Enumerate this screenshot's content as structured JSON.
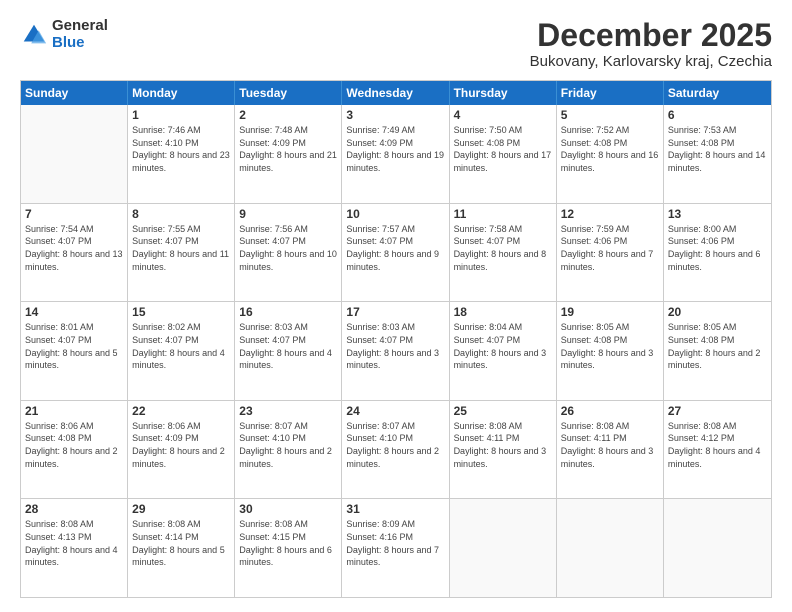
{
  "logo": {
    "general": "General",
    "blue": "Blue"
  },
  "title": "December 2025",
  "subtitle": "Bukovany, Karlovarsky kraj, Czechia",
  "headers": [
    "Sunday",
    "Monday",
    "Tuesday",
    "Wednesday",
    "Thursday",
    "Friday",
    "Saturday"
  ],
  "weeks": [
    [
      {
        "day": "",
        "sunrise": "",
        "sunset": "",
        "daylight": ""
      },
      {
        "day": "1",
        "sunrise": "Sunrise: 7:46 AM",
        "sunset": "Sunset: 4:10 PM",
        "daylight": "Daylight: 8 hours and 23 minutes."
      },
      {
        "day": "2",
        "sunrise": "Sunrise: 7:48 AM",
        "sunset": "Sunset: 4:09 PM",
        "daylight": "Daylight: 8 hours and 21 minutes."
      },
      {
        "day": "3",
        "sunrise": "Sunrise: 7:49 AM",
        "sunset": "Sunset: 4:09 PM",
        "daylight": "Daylight: 8 hours and 19 minutes."
      },
      {
        "day": "4",
        "sunrise": "Sunrise: 7:50 AM",
        "sunset": "Sunset: 4:08 PM",
        "daylight": "Daylight: 8 hours and 17 minutes."
      },
      {
        "day": "5",
        "sunrise": "Sunrise: 7:52 AM",
        "sunset": "Sunset: 4:08 PM",
        "daylight": "Daylight: 8 hours and 16 minutes."
      },
      {
        "day": "6",
        "sunrise": "Sunrise: 7:53 AM",
        "sunset": "Sunset: 4:08 PM",
        "daylight": "Daylight: 8 hours and 14 minutes."
      }
    ],
    [
      {
        "day": "7",
        "sunrise": "Sunrise: 7:54 AM",
        "sunset": "Sunset: 4:07 PM",
        "daylight": "Daylight: 8 hours and 13 minutes."
      },
      {
        "day": "8",
        "sunrise": "Sunrise: 7:55 AM",
        "sunset": "Sunset: 4:07 PM",
        "daylight": "Daylight: 8 hours and 11 minutes."
      },
      {
        "day": "9",
        "sunrise": "Sunrise: 7:56 AM",
        "sunset": "Sunset: 4:07 PM",
        "daylight": "Daylight: 8 hours and 10 minutes."
      },
      {
        "day": "10",
        "sunrise": "Sunrise: 7:57 AM",
        "sunset": "Sunset: 4:07 PM",
        "daylight": "Daylight: 8 hours and 9 minutes."
      },
      {
        "day": "11",
        "sunrise": "Sunrise: 7:58 AM",
        "sunset": "Sunset: 4:07 PM",
        "daylight": "Daylight: 8 hours and 8 minutes."
      },
      {
        "day": "12",
        "sunrise": "Sunrise: 7:59 AM",
        "sunset": "Sunset: 4:06 PM",
        "daylight": "Daylight: 8 hours and 7 minutes."
      },
      {
        "day": "13",
        "sunrise": "Sunrise: 8:00 AM",
        "sunset": "Sunset: 4:06 PM",
        "daylight": "Daylight: 8 hours and 6 minutes."
      }
    ],
    [
      {
        "day": "14",
        "sunrise": "Sunrise: 8:01 AM",
        "sunset": "Sunset: 4:07 PM",
        "daylight": "Daylight: 8 hours and 5 minutes."
      },
      {
        "day": "15",
        "sunrise": "Sunrise: 8:02 AM",
        "sunset": "Sunset: 4:07 PM",
        "daylight": "Daylight: 8 hours and 4 minutes."
      },
      {
        "day": "16",
        "sunrise": "Sunrise: 8:03 AM",
        "sunset": "Sunset: 4:07 PM",
        "daylight": "Daylight: 8 hours and 4 minutes."
      },
      {
        "day": "17",
        "sunrise": "Sunrise: 8:03 AM",
        "sunset": "Sunset: 4:07 PM",
        "daylight": "Daylight: 8 hours and 3 minutes."
      },
      {
        "day": "18",
        "sunrise": "Sunrise: 8:04 AM",
        "sunset": "Sunset: 4:07 PM",
        "daylight": "Daylight: 8 hours and 3 minutes."
      },
      {
        "day": "19",
        "sunrise": "Sunrise: 8:05 AM",
        "sunset": "Sunset: 4:08 PM",
        "daylight": "Daylight: 8 hours and 3 minutes."
      },
      {
        "day": "20",
        "sunrise": "Sunrise: 8:05 AM",
        "sunset": "Sunset: 4:08 PM",
        "daylight": "Daylight: 8 hours and 2 minutes."
      }
    ],
    [
      {
        "day": "21",
        "sunrise": "Sunrise: 8:06 AM",
        "sunset": "Sunset: 4:08 PM",
        "daylight": "Daylight: 8 hours and 2 minutes."
      },
      {
        "day": "22",
        "sunrise": "Sunrise: 8:06 AM",
        "sunset": "Sunset: 4:09 PM",
        "daylight": "Daylight: 8 hours and 2 minutes."
      },
      {
        "day": "23",
        "sunrise": "Sunrise: 8:07 AM",
        "sunset": "Sunset: 4:10 PM",
        "daylight": "Daylight: 8 hours and 2 minutes."
      },
      {
        "day": "24",
        "sunrise": "Sunrise: 8:07 AM",
        "sunset": "Sunset: 4:10 PM",
        "daylight": "Daylight: 8 hours and 2 minutes."
      },
      {
        "day": "25",
        "sunrise": "Sunrise: 8:08 AM",
        "sunset": "Sunset: 4:11 PM",
        "daylight": "Daylight: 8 hours and 3 minutes."
      },
      {
        "day": "26",
        "sunrise": "Sunrise: 8:08 AM",
        "sunset": "Sunset: 4:11 PM",
        "daylight": "Daylight: 8 hours and 3 minutes."
      },
      {
        "day": "27",
        "sunrise": "Sunrise: 8:08 AM",
        "sunset": "Sunset: 4:12 PM",
        "daylight": "Daylight: 8 hours and 4 minutes."
      }
    ],
    [
      {
        "day": "28",
        "sunrise": "Sunrise: 8:08 AM",
        "sunset": "Sunset: 4:13 PM",
        "daylight": "Daylight: 8 hours and 4 minutes."
      },
      {
        "day": "29",
        "sunrise": "Sunrise: 8:08 AM",
        "sunset": "Sunset: 4:14 PM",
        "daylight": "Daylight: 8 hours and 5 minutes."
      },
      {
        "day": "30",
        "sunrise": "Sunrise: 8:08 AM",
        "sunset": "Sunset: 4:15 PM",
        "daylight": "Daylight: 8 hours and 6 minutes."
      },
      {
        "day": "31",
        "sunrise": "Sunrise: 8:09 AM",
        "sunset": "Sunset: 4:16 PM",
        "daylight": "Daylight: 8 hours and 7 minutes."
      },
      {
        "day": "",
        "sunrise": "",
        "sunset": "",
        "daylight": ""
      },
      {
        "day": "",
        "sunrise": "",
        "sunset": "",
        "daylight": ""
      },
      {
        "day": "",
        "sunrise": "",
        "sunset": "",
        "daylight": ""
      }
    ]
  ]
}
